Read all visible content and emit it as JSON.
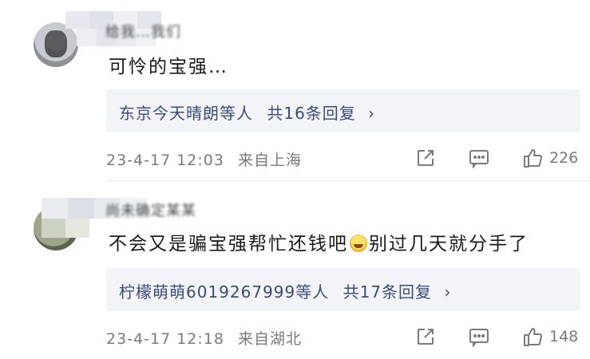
{
  "comments": [
    {
      "username": "给我…我们",
      "text": "可怜的宝强…",
      "text_after_emoji": "",
      "replies_names": "东京今天晴朗等人",
      "replies_count": "共16条回复",
      "reply_chevron": "›",
      "date": "23-4-17 12:03",
      "location": "来自上海",
      "likes": "226"
    },
    {
      "username": "尚未确定某某",
      "text": "不会又是骗宝强帮忙还钱吧",
      "text_after_emoji": "别过几天就分手了",
      "replies_names": "柠檬萌萌6019267999等人",
      "replies_count": "共17条回复",
      "reply_chevron": "›",
      "date": "23-4-17 12:18",
      "location": "来自湖北",
      "likes": "148"
    }
  ],
  "icons": {
    "share": "share-icon",
    "comment": "comment-icon",
    "like": "thumbs-up-icon",
    "emoji": "laughing-emoji-icon"
  },
  "colors": {
    "reply_link": "#3b4b7a",
    "meta": "#7a7a7a",
    "reply_bg": "#f3f4f7"
  }
}
